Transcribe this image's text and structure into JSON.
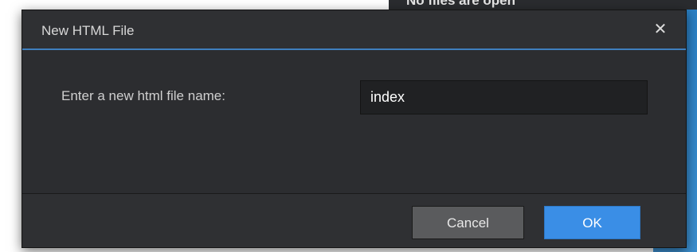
{
  "background": {
    "partial_text": "No files are open"
  },
  "dialog": {
    "title": "New HTML File",
    "close_icon": "close-icon",
    "prompt_label": "Enter a new html file name:",
    "filename_value": "index",
    "cancel_label": "Cancel",
    "ok_label": "OK"
  },
  "colors": {
    "accent": "#3f7fbe",
    "ok_button": "#3a8ee6",
    "dialog_bg": "#2c2d30",
    "cancel_button": "#5a5b5d"
  }
}
